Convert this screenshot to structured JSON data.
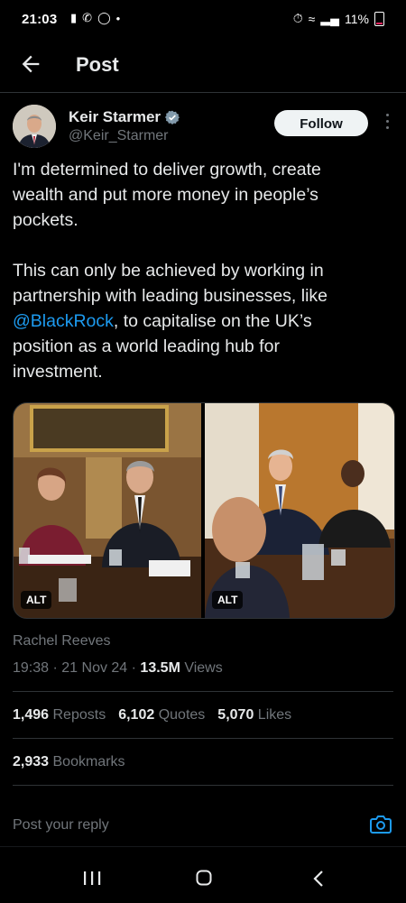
{
  "status_bar": {
    "time": "21:03",
    "battery": "11%"
  },
  "header": {
    "title": "Post"
  },
  "author": {
    "name": "Keir Starmer",
    "handle": "@Keir_Starmer",
    "follow_label": "Follow"
  },
  "tweet": {
    "paragraph1": "I'm determined to deliver growth, create wealth and put more money in people’s pockets.",
    "paragraph2_before": "This can only be achieved by working in partnership with leading businesses, like ",
    "mention": "@BlackRock",
    "paragraph2_after": ", to capitalise on the UK’s position as a world leading hub for investment."
  },
  "media": {
    "alt_badge_1": "ALT",
    "alt_badge_2": "ALT"
  },
  "photo_caption": "Rachel Reeves",
  "meta": {
    "time": "19:38",
    "date": "21 Nov 24",
    "views_count": "13.5M",
    "views_label": "Views"
  },
  "stats": {
    "reposts_count": "1,496",
    "reposts_label": "Reposts",
    "quotes_count": "6,102",
    "quotes_label": "Quotes",
    "likes_count": "5,070",
    "likes_label": "Likes",
    "bookmarks_count": "2,933",
    "bookmarks_label": "Bookmarks"
  },
  "reply": {
    "placeholder": "Post your reply"
  },
  "colors": {
    "background": "#000000",
    "accent": "#1d9bf0",
    "muted": "#71767b",
    "divider": "#2f3336"
  }
}
